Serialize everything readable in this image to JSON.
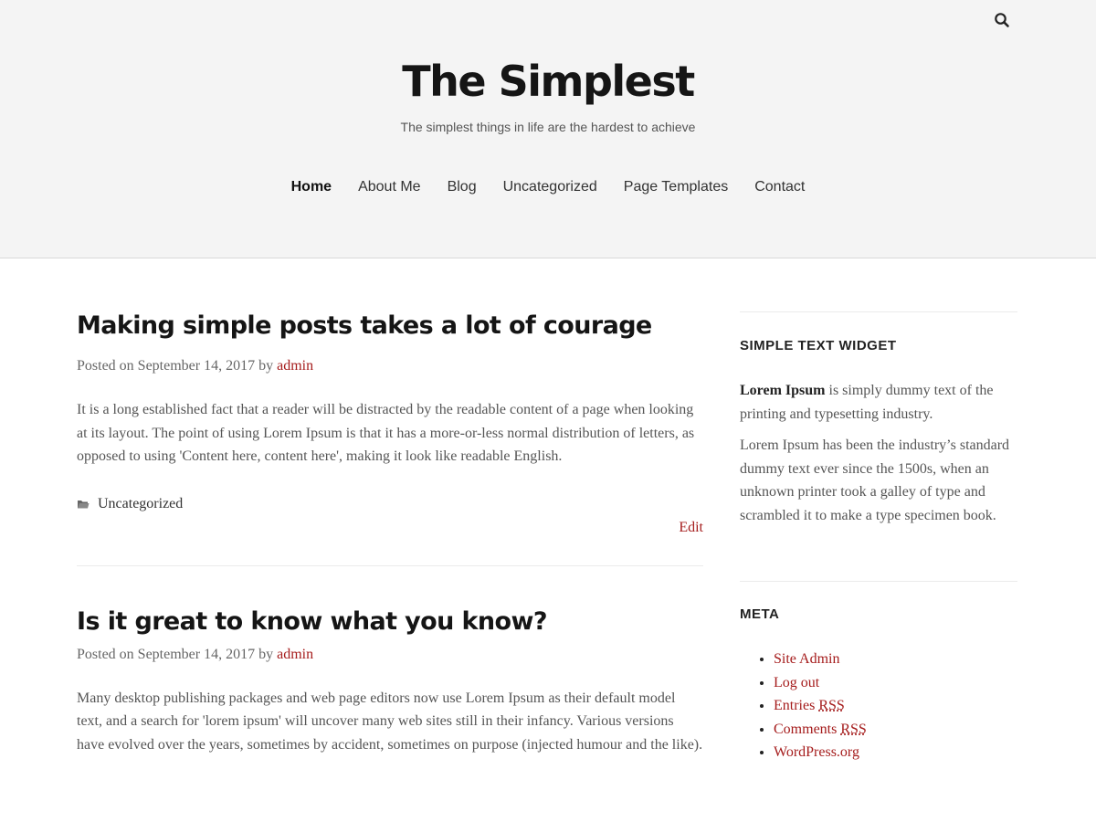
{
  "header": {
    "site_title": "The Simplest",
    "site_description": "The simplest things in life are the hardest to achieve",
    "search_icon": "search-icon",
    "nav": [
      {
        "label": "Home",
        "active": true
      },
      {
        "label": "About Me"
      },
      {
        "label": "Blog"
      },
      {
        "label": "Uncategorized"
      },
      {
        "label": "Page Templates"
      },
      {
        "label": "Contact"
      }
    ]
  },
  "posts": [
    {
      "title": "Making simple posts takes a lot of courage",
      "posted_on_prefix": "Posted on",
      "date": "September 14, 2017",
      "by_label": "by",
      "author": "admin",
      "excerpt": "It is a long established fact that a reader will be distracted by the readable content of a page when looking at its layout. The point of using Lorem Ipsum is that it has a more-or-less normal distribution of letters, as opposed to using 'Content here, content here', making it look like readable English.",
      "category": "Uncategorized",
      "category_icon": "folder-icon",
      "edit_label": "Edit"
    },
    {
      "title": "Is it great to know what you know?",
      "posted_on_prefix": "Posted on",
      "date": "September 14, 2017",
      "by_label": "by",
      "author": "admin",
      "excerpt": "Many desktop publishing packages and web page editors now use Lorem Ipsum as their default model text, and a search for 'lorem ipsum' will uncover many web sites still in their infancy. Various versions have evolved over the years, sometimes by accident, sometimes on purpose (injected humour and the like)."
    }
  ],
  "sidebar": {
    "text_widget": {
      "title": "SIMPLE TEXT WIDGET",
      "para1_bold": "Lorem Ipsum",
      "para1_rest": " is simply dummy text of the printing and typesetting industry.",
      "para2": "Lorem Ipsum has been the industry’s standard dummy text ever since the 1500s, when an unknown printer took a galley of type and scrambled it to make a type specimen book."
    },
    "meta_widget": {
      "title": "META",
      "items": [
        {
          "text": "Site Admin"
        },
        {
          "text": "Log out"
        },
        {
          "text": "Entries ",
          "abbr": "RSS"
        },
        {
          "text": "Comments ",
          "abbr": "RSS"
        },
        {
          "text": "WordPress.org"
        }
      ]
    }
  },
  "colors": {
    "header_bg": "#f4f4f4",
    "link": "#a51c1c",
    "title": "#151515"
  }
}
